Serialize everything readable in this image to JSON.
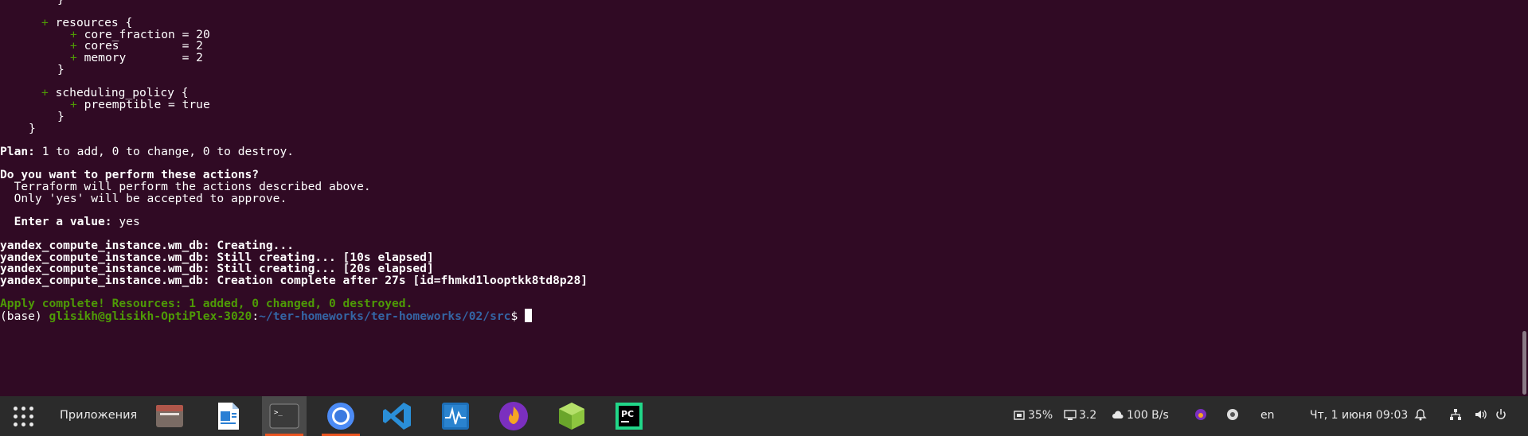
{
  "terminal": {
    "resources_line": "resources {",
    "core_fraction_line": "core_fraction = 20",
    "cores_line": "cores         = 2",
    "memory_line": "memory        = 2",
    "close_brace": "}",
    "scheduling_line": "scheduling_policy {",
    "preemptible_line": "preemptible = true",
    "plus_sign": "+",
    "plan_label": "Plan:",
    "plan_text": " 1 to add, 0 to change, 0 to destroy.",
    "question": "Do you want to perform these actions?",
    "explain1": "  Terraform will perform the actions described above.",
    "explain2": "  Only 'yes' will be accepted to approve.",
    "enter_label": "  Enter a value:",
    "enter_value": " yes",
    "resource_prefix": "yandex_compute_instance.wm_db:",
    "creating": " Creating...",
    "still10": " Still creating... [10s elapsed]",
    "still20": " Still creating... [20s elapsed]",
    "complete": " Creation complete after 27s [id=fhmkd1looptkk8td8p28]",
    "apply_complete": "Apply complete! Resources: 1 added, 0 changed, 0 destroyed.",
    "prompt_env": "(base) ",
    "prompt_user": "glisikh@glisikh-OptiPlex-3020",
    "prompt_colon": ":",
    "prompt_path": "~/ter-homeworks/ter-homeworks/02/src",
    "prompt_dollar": "$ "
  },
  "taskbar": {
    "apps_label": "Приложения",
    "dock_icons": [
      "files-icon",
      "writer-icon",
      "terminal-icon",
      "chromium-icon",
      "vscode-icon",
      "system-monitor-icon",
      "flameshot-icon",
      "box-icon",
      "pycharm-icon"
    ],
    "cpu": "35%",
    "load": "3.2",
    "net": "100 B/s",
    "lang": "en",
    "datetime": "Чт, 1 июня  09:03"
  },
  "colors": {
    "terminal_bg": "#300a24",
    "green": "#4e9a06",
    "blue": "#3465a4",
    "taskbar_bg": "#2b2b2b",
    "running_indicator": "#e95420"
  }
}
